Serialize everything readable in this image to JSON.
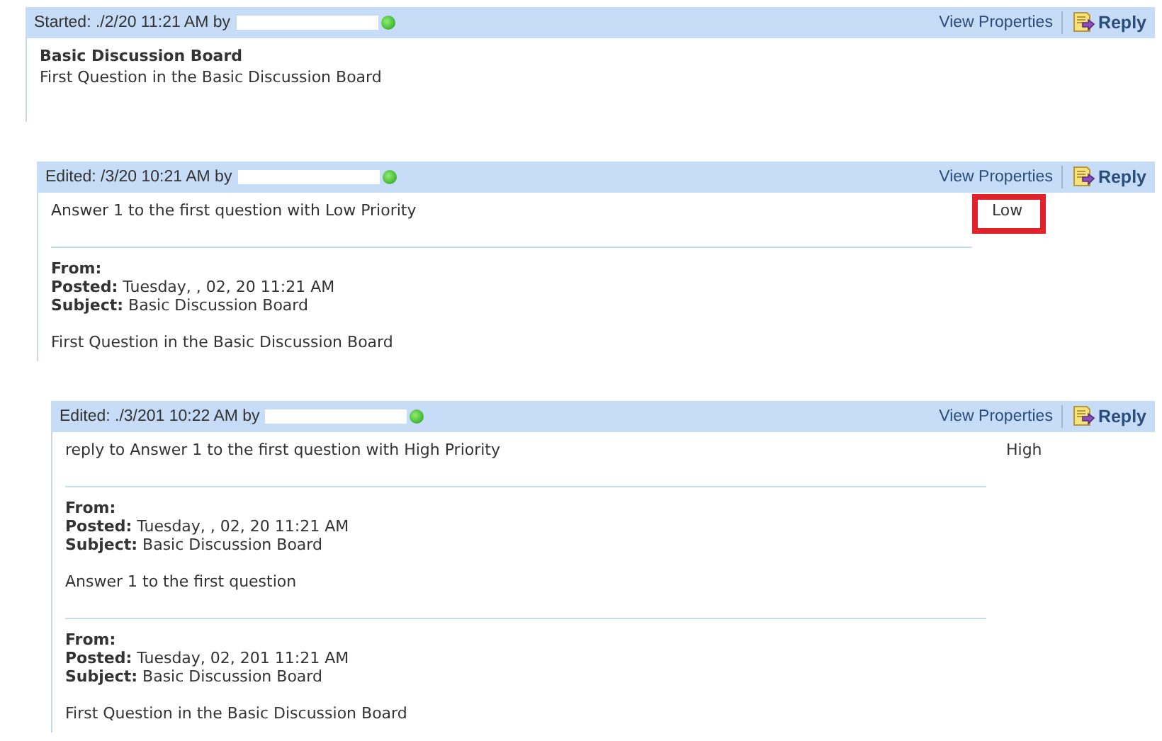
{
  "posts": [
    {
      "header": "Started: ./2/20 11:21 AM by",
      "online": true,
      "title": "Basic Discussion Board",
      "message": "First Question in the Basic Discussion Board",
      "view_properties": "View Properties",
      "reply": "Reply",
      "children": [
        {
          "header": "Edited: /3/20 10:21 AM by",
          "online": true,
          "message": "Answer 1 to the first question with Low Priority",
          "priority": {
            "label": "Low",
            "highlighted": true
          },
          "view_properties": "View Properties",
          "reply": "Reply",
          "quotes": [
            {
              "from_label": "From:",
              "posted_label": "Posted:",
              "posted": "Tuesday, , 02, 20 11:21 AM",
              "subject_label": "Subject:",
              "subject": "Basic Discussion Board",
              "body": "First Question in the Basic Discussion Board"
            }
          ],
          "children": [
            {
              "header": "Edited: ./3/201 10:22 AM by",
              "online": true,
              "message": "reply to Answer 1 to the first question with High Priority",
              "priority": {
                "label": "High",
                "highlighted": false
              },
              "view_properties": "View Properties",
              "reply": "Reply",
              "quotes": [
                {
                  "from_label": "From:",
                  "posted_label": "Posted:",
                  "posted": "Tuesday, , 02, 20 11:21 AM",
                  "subject_label": "Subject:",
                  "subject": "Basic Discussion Board",
                  "body": "Answer 1 to the first question"
                },
                {
                  "from_label": "From:",
                  "posted_label": "Posted:",
                  "posted": "Tuesday, 02, 201 11:21 AM",
                  "subject_label": "Subject:",
                  "subject": "Basic Discussion Board",
                  "body": "First Question in the Basic Discussion Board"
                }
              ]
            }
          ]
        }
      ]
    }
  ]
}
